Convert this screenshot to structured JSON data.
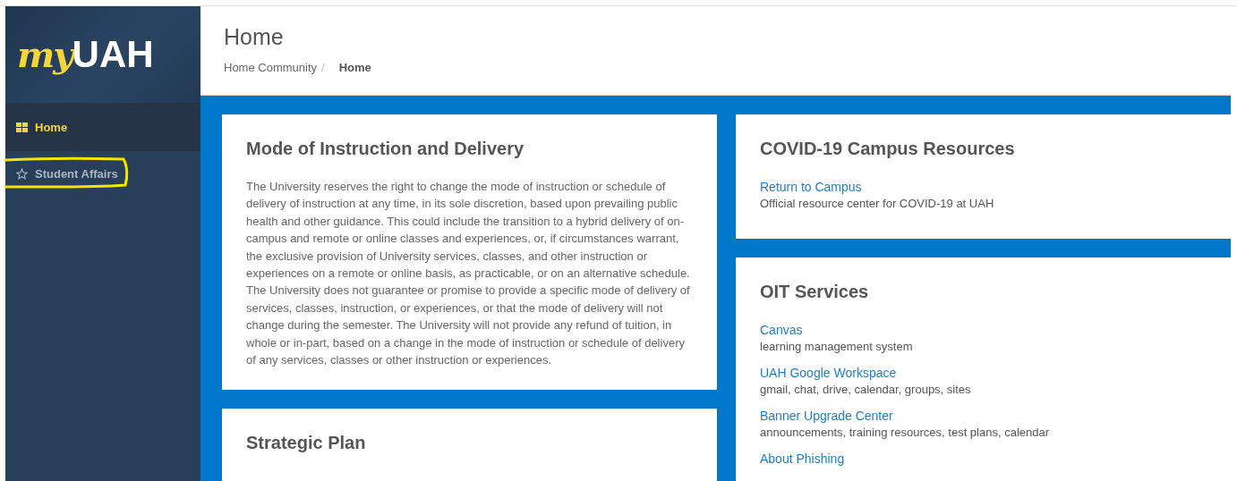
{
  "logo": {
    "script": "my",
    "wordmark": "UAH"
  },
  "sidebar": {
    "items": [
      {
        "label": "Home",
        "kind": "grid",
        "selected": true,
        "highlighted": false
      },
      {
        "label": "Student Affairs",
        "kind": "star",
        "selected": false,
        "highlighted": true
      }
    ]
  },
  "header": {
    "title": "Home",
    "separator": "/",
    "breadcrumb": [
      {
        "label": "Home Community",
        "current": false
      },
      {
        "label": "Home",
        "current": true
      }
    ]
  },
  "left_column": [
    {
      "title": "Mode of Instruction and Delivery",
      "body": "The University reserves the right to change the mode of instruction or schedule of delivery of instruction at any time, in its sole discretion, based upon prevailing public health and other guidance. This could include the transition to a hybrid delivery of on-campus and remote or online classes and experiences, or, if circumstances warrant, the exclusive provision of University services, classes, and other instruction or experiences on a remote or online basis, as practicable, or on an alternative schedule. The University does not guarantee or promise to provide a specific mode of delivery of services, classes, instruction, or experiences, or that the mode of delivery will not change during the semester. The University will not provide any refund of tuition, in whole or in-part, based on a change in the mode of instruction or schedule of delivery of any services, classes or other instruction or experiences."
    },
    {
      "title": "Strategic Plan"
    }
  ],
  "right_column": [
    {
      "title": "COVID-19 Campus Resources",
      "links": [
        {
          "label": "Return to Campus",
          "description": "Official resource center for COVID-19 at UAH"
        }
      ]
    },
    {
      "title": "OIT Services",
      "links": [
        {
          "label": "Canvas",
          "description": "learning management system"
        },
        {
          "label": "UAH Google Workspace",
          "description": "gmail, chat, drive, calendar, groups, sites"
        },
        {
          "label": "Banner Upgrade Center",
          "description": "announcements, training resources, test plans, calendar"
        },
        {
          "label": "About Phishing"
        }
      ]
    }
  ]
}
